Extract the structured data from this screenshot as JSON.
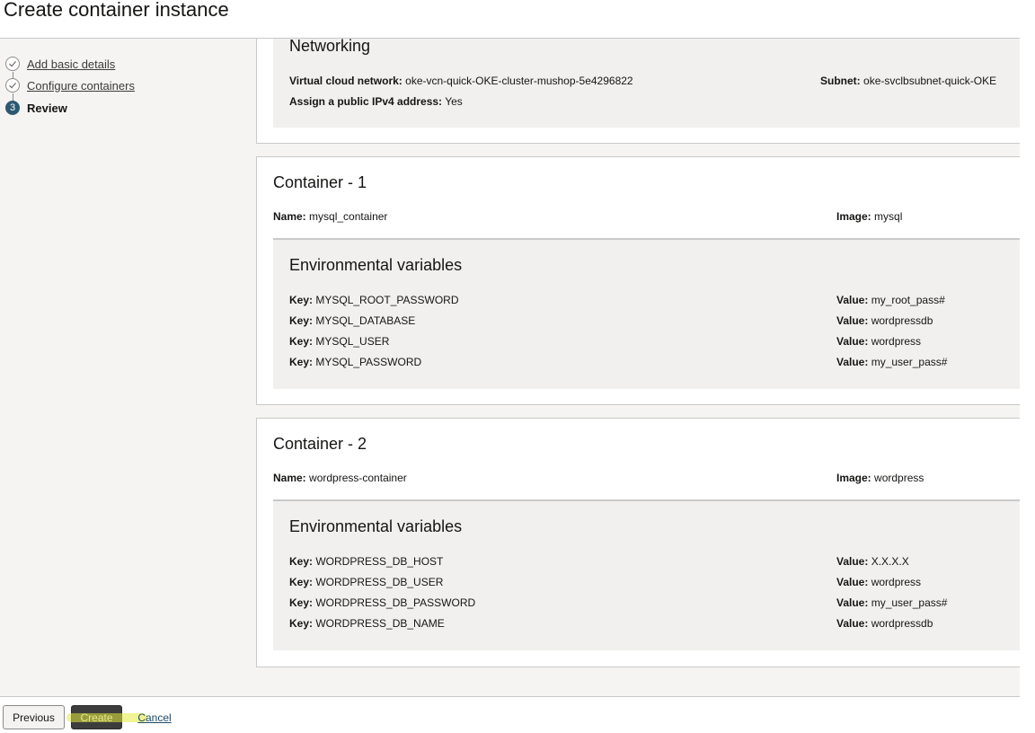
{
  "page": {
    "title": "Create container instance"
  },
  "steps": [
    {
      "label": "Add basic details",
      "state": "complete"
    },
    {
      "label": "Configure containers",
      "state": "complete"
    },
    {
      "number": "3",
      "label": "Review",
      "state": "current"
    }
  ],
  "networking": {
    "heading": "Networking",
    "vcn_label": "Virtual cloud network:",
    "vcn_value": "oke-vcn-quick-OKE-cluster-mushop-5e4296822",
    "subnet_label": "Subnet:",
    "subnet_value": "oke-svclbsubnet-quick-OKE",
    "public_ip_label": "Assign a public IPv4 address:",
    "public_ip_value": "Yes"
  },
  "containers": [
    {
      "heading": "Container - 1",
      "name_label": "Name:",
      "name": "mysql_container",
      "image_label": "Image:",
      "image": "mysql",
      "env_heading": "Environmental variables",
      "env": [
        {
          "key_label": "Key:",
          "key": "MYSQL_ROOT_PASSWORD",
          "value_label": "Value:",
          "value": "my_root_pass#"
        },
        {
          "key_label": "Key:",
          "key": "MYSQL_DATABASE",
          "value_label": "Value:",
          "value": "wordpressdb"
        },
        {
          "key_label": "Key:",
          "key": "MYSQL_USER",
          "value_label": "Value:",
          "value": "wordpress"
        },
        {
          "key_label": "Key:",
          "key": "MYSQL_PASSWORD",
          "value_label": "Value:",
          "value": "my_user_pass#"
        }
      ]
    },
    {
      "heading": "Container - 2",
      "name_label": "Name:",
      "name": "wordpress-container",
      "image_label": "Image:",
      "image": "wordpress",
      "env_heading": "Environmental variables",
      "env": [
        {
          "key_label": "Key:",
          "key": "WORDPRESS_DB_HOST",
          "value_label": "Value:",
          "value": "X.X.X.X"
        },
        {
          "key_label": "Key:",
          "key": "WORDPRESS_DB_USER",
          "value_label": "Value:",
          "value": "wordpress"
        },
        {
          "key_label": "Key:",
          "key": "WORDPRESS_DB_PASSWORD",
          "value_label": "Value:",
          "value": "my_user_pass#"
        },
        {
          "key_label": "Key:",
          "key": "WORDPRESS_DB_NAME",
          "value_label": "Value:",
          "value": "wordpressdb"
        }
      ]
    }
  ],
  "footer": {
    "previous_label": "Previous",
    "create_label": "Create",
    "cancel_label": "Cancel"
  },
  "colors": {
    "current_step": "#2c5972",
    "create_button": "#3d3d3d",
    "create_highlight": "#e6eb3c"
  },
  "icons": {
    "complete_step": "check-circle-icon"
  }
}
